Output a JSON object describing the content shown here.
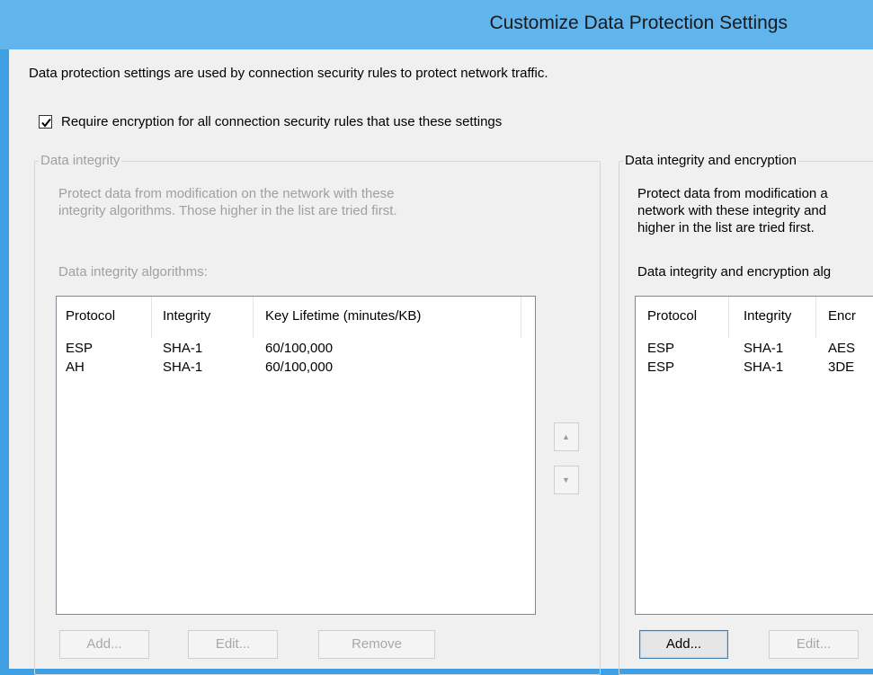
{
  "window": {
    "title": "Customize Data Protection Settings"
  },
  "description": "Data protection settings are used by connection security rules to protect network traffic.",
  "require_encryption": {
    "label": "Require encryption for all connection security rules that use these settings",
    "checked": true
  },
  "integrity_group": {
    "legend": "Data integrity",
    "desc_line1": "Protect data from modification on the network with these",
    "desc_line2": "integrity algorithms. Those higher in the list are tried first.",
    "list_label": "Data integrity algorithms:",
    "columns": [
      "Protocol",
      "Integrity",
      "Key Lifetime (minutes/KB)"
    ],
    "rows": [
      [
        "ESP",
        "SHA-1",
        "60/100,000"
      ],
      [
        "AH",
        "SHA-1",
        "60/100,000"
      ]
    ],
    "buttons": {
      "add": "Add...",
      "edit": "Edit...",
      "remove": "Remove"
    },
    "move_up_icon": "triangle-up",
    "move_down_icon": "triangle-down"
  },
  "encryption_group": {
    "legend": "Data integrity and encryption",
    "desc_line1": "Protect data from modification a",
    "desc_line2": "network with these integrity and",
    "desc_line3": "higher in the list are tried first.",
    "list_label": "Data integrity and encryption alg",
    "columns": [
      "Protocol",
      "Integrity",
      "Encr"
    ],
    "rows": [
      [
        "ESP",
        "SHA-1",
        "AES"
      ],
      [
        "ESP",
        "SHA-1",
        "3DE"
      ]
    ],
    "buttons": {
      "add": "Add...",
      "edit": "Edit..."
    }
  },
  "colors": {
    "titlebar": "#62b4ec",
    "border_accent": "#3ea0e2",
    "dialog_bg": "#f0f0f0",
    "disabled_text": "#a0a0a0"
  }
}
